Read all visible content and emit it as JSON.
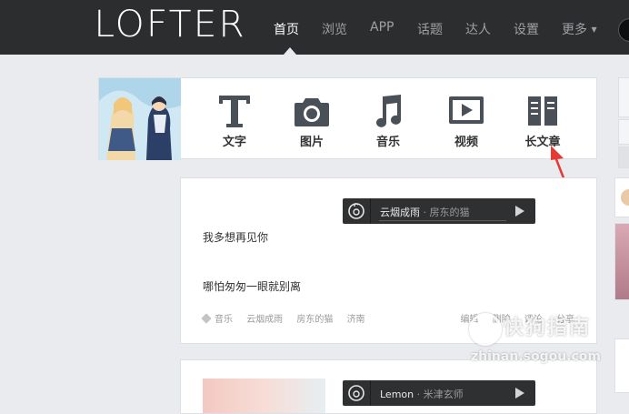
{
  "brand": {
    "logo": "LOFTER"
  },
  "nav": {
    "items": [
      {
        "label": "首页",
        "active": true
      },
      {
        "label": "浏览",
        "active": false
      },
      {
        "label": "APP",
        "active": false
      },
      {
        "label": "话题",
        "active": false
      },
      {
        "label": "达人",
        "active": false
      },
      {
        "label": "设置",
        "active": false
      },
      {
        "label": "更多",
        "active": false
      }
    ]
  },
  "publish": {
    "tools": [
      {
        "label": "文字",
        "icon": "text-icon"
      },
      {
        "label": "图片",
        "icon": "camera-icon"
      },
      {
        "label": "音乐",
        "icon": "music-note-icon"
      },
      {
        "label": "视频",
        "icon": "video-icon"
      },
      {
        "label": "长文章",
        "icon": "long-article-icon"
      }
    ]
  },
  "post": {
    "song": {
      "title": "云烟成雨",
      "artist": "· 房东的猫"
    },
    "lines": [
      "我多想再见你",
      "哪怕匆匆一眼就别离"
    ],
    "tags": [
      "音乐",
      "云烟成雨",
      "房东的猫",
      "济南"
    ],
    "actions": [
      "编辑",
      "删除",
      "评论",
      "分享"
    ]
  },
  "post2": {
    "song": {
      "title": "Lemon",
      "artist": "· 米津玄师"
    }
  },
  "watermark": {
    "title": "快狗指南",
    "url": "zhinan.sogou.com"
  },
  "colors": {
    "topbar": "#2b2d2f",
    "background": "#e9ebee",
    "accent_arrow": "#e53935"
  }
}
